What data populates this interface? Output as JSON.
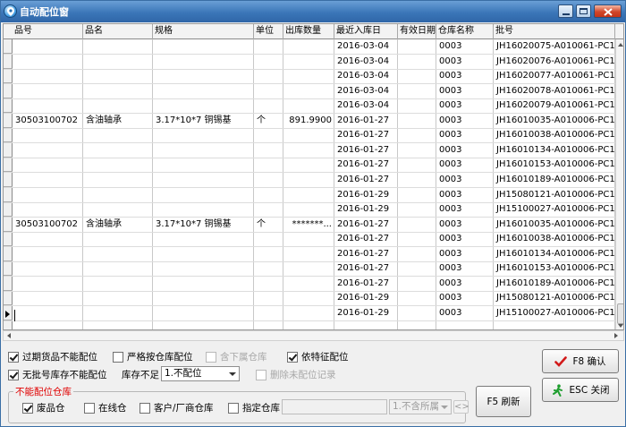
{
  "window": {
    "title": "自动配位窗"
  },
  "grid": {
    "columns": [
      "品号",
      "品名",
      "规格",
      "单位",
      "出库数量",
      "最近入库日",
      "有效日期",
      "仓库名称",
      "批号"
    ],
    "rows": [
      {
        "code": "",
        "name": "",
        "spec": "",
        "unit": "",
        "qty": "",
        "date": "2016-03-04",
        "expiry": "",
        "warehouse": "0003",
        "batch": "JH16020075-A010061-PC16"
      },
      {
        "code": "",
        "name": "",
        "spec": "",
        "unit": "",
        "qty": "",
        "date": "2016-03-04",
        "expiry": "",
        "warehouse": "0003",
        "batch": "JH16020076-A010061-PC16"
      },
      {
        "code": "",
        "name": "",
        "spec": "",
        "unit": "",
        "qty": "",
        "date": "2016-03-04",
        "expiry": "",
        "warehouse": "0003",
        "batch": "JH16020077-A010061-PC16"
      },
      {
        "code": "",
        "name": "",
        "spec": "",
        "unit": "",
        "qty": "",
        "date": "2016-03-04",
        "expiry": "",
        "warehouse": "0003",
        "batch": "JH16020078-A010061-PC16"
      },
      {
        "code": "",
        "name": "",
        "spec": "",
        "unit": "",
        "qty": "",
        "date": "2016-03-04",
        "expiry": "",
        "warehouse": "0003",
        "batch": "JH16020079-A010061-PC16"
      },
      {
        "code": "30503100702",
        "name": "含油轴承",
        "spec": "3.17*10*7 铜锡基",
        "unit": "个",
        "qty": "891.9900",
        "date": "2016-01-27",
        "expiry": "",
        "warehouse": "0003",
        "batch": "JH16010035-A010006-PC16"
      },
      {
        "code": "",
        "name": "",
        "spec": "",
        "unit": "",
        "qty": "",
        "date": "2016-01-27",
        "expiry": "",
        "warehouse": "0003",
        "batch": "JH16010038-A010006-PC16"
      },
      {
        "code": "",
        "name": "",
        "spec": "",
        "unit": "",
        "qty": "",
        "date": "2016-01-27",
        "expiry": "",
        "warehouse": "0003",
        "batch": "JH16010134-A010006-PC16"
      },
      {
        "code": "",
        "name": "",
        "spec": "",
        "unit": "",
        "qty": "",
        "date": "2016-01-27",
        "expiry": "",
        "warehouse": "0003",
        "batch": "JH16010153-A010006-PC16"
      },
      {
        "code": "",
        "name": "",
        "spec": "",
        "unit": "",
        "qty": "",
        "date": "2016-01-27",
        "expiry": "",
        "warehouse": "0003",
        "batch": "JH16010189-A010006-PC16"
      },
      {
        "code": "",
        "name": "",
        "spec": "",
        "unit": "",
        "qty": "",
        "date": "2016-01-29",
        "expiry": "",
        "warehouse": "0003",
        "batch": "JH15080121-A010006-PC16"
      },
      {
        "code": "",
        "name": "",
        "spec": "",
        "unit": "",
        "qty": "",
        "date": "2016-01-29",
        "expiry": "",
        "warehouse": "0003",
        "batch": "JH15100027-A010006-PC16"
      },
      {
        "code": "30503100702",
        "name": "含油轴承",
        "spec": "3.17*10*7 铜锡基",
        "unit": "个",
        "qty": "*******...",
        "date": "2016-01-27",
        "expiry": "",
        "warehouse": "0003",
        "batch": "JH16010035-A010006-PC16"
      },
      {
        "code": "",
        "name": "",
        "spec": "",
        "unit": "",
        "qty": "",
        "date": "2016-01-27",
        "expiry": "",
        "warehouse": "0003",
        "batch": "JH16010038-A010006-PC16"
      },
      {
        "code": "",
        "name": "",
        "spec": "",
        "unit": "",
        "qty": "",
        "date": "2016-01-27",
        "expiry": "",
        "warehouse": "0003",
        "batch": "JH16010134-A010006-PC16"
      },
      {
        "code": "",
        "name": "",
        "spec": "",
        "unit": "",
        "qty": "",
        "date": "2016-01-27",
        "expiry": "",
        "warehouse": "0003",
        "batch": "JH16010153-A010006-PC16"
      },
      {
        "code": "",
        "name": "",
        "spec": "",
        "unit": "",
        "qty": "",
        "date": "2016-01-27",
        "expiry": "",
        "warehouse": "0003",
        "batch": "JH16010189-A010006-PC16"
      },
      {
        "code": "",
        "name": "",
        "spec": "",
        "unit": "",
        "qty": "",
        "date": "2016-01-29",
        "expiry": "",
        "warehouse": "0003",
        "batch": "JH15080121-A010006-PC16"
      },
      {
        "code": "",
        "name": "",
        "spec": "",
        "unit": "",
        "qty": "",
        "date": "2016-01-29",
        "expiry": "",
        "warehouse": "0003",
        "batch": "JH15100027-A010006-PC16"
      }
    ]
  },
  "options": {
    "expired_no_allocate": {
      "label": "过期货品不能配位",
      "checked": true
    },
    "strict_by_warehouse": {
      "label": "严格按仓库配位",
      "checked": false
    },
    "include_sub_warehouse": {
      "label": "含下属仓库",
      "checked": false
    },
    "by_feature": {
      "label": "依特征配位",
      "checked": true
    },
    "no_batch_no_allocate": {
      "label": "无批号库存不能配位",
      "checked": true
    },
    "stock_short_label": "库存不足",
    "stock_short_value": "1.不配位",
    "delete_unallocated": {
      "label": "删除未配位记录",
      "checked": false
    }
  },
  "exclude_group": {
    "legend": "不能配位仓库",
    "defective": {
      "label": "废品仓",
      "checked": true
    },
    "in_transit": {
      "label": "在线仓",
      "checked": false
    },
    "customer_vendor": {
      "label": "客户/厂商仓库",
      "checked": false
    },
    "specified": {
      "label": "指定仓库",
      "checked": false
    },
    "scope_value": "1.不含所属",
    "range_btn": "<>"
  },
  "buttons": {
    "refresh": "F5 刷新",
    "confirm": "F8 确认",
    "close": "ESC 关闭"
  },
  "colors": {
    "title_bar": "#3b76b8",
    "legend_red": "#e00000",
    "confirm_check": "#d21a1a",
    "close_green": "#1f9e2f"
  }
}
